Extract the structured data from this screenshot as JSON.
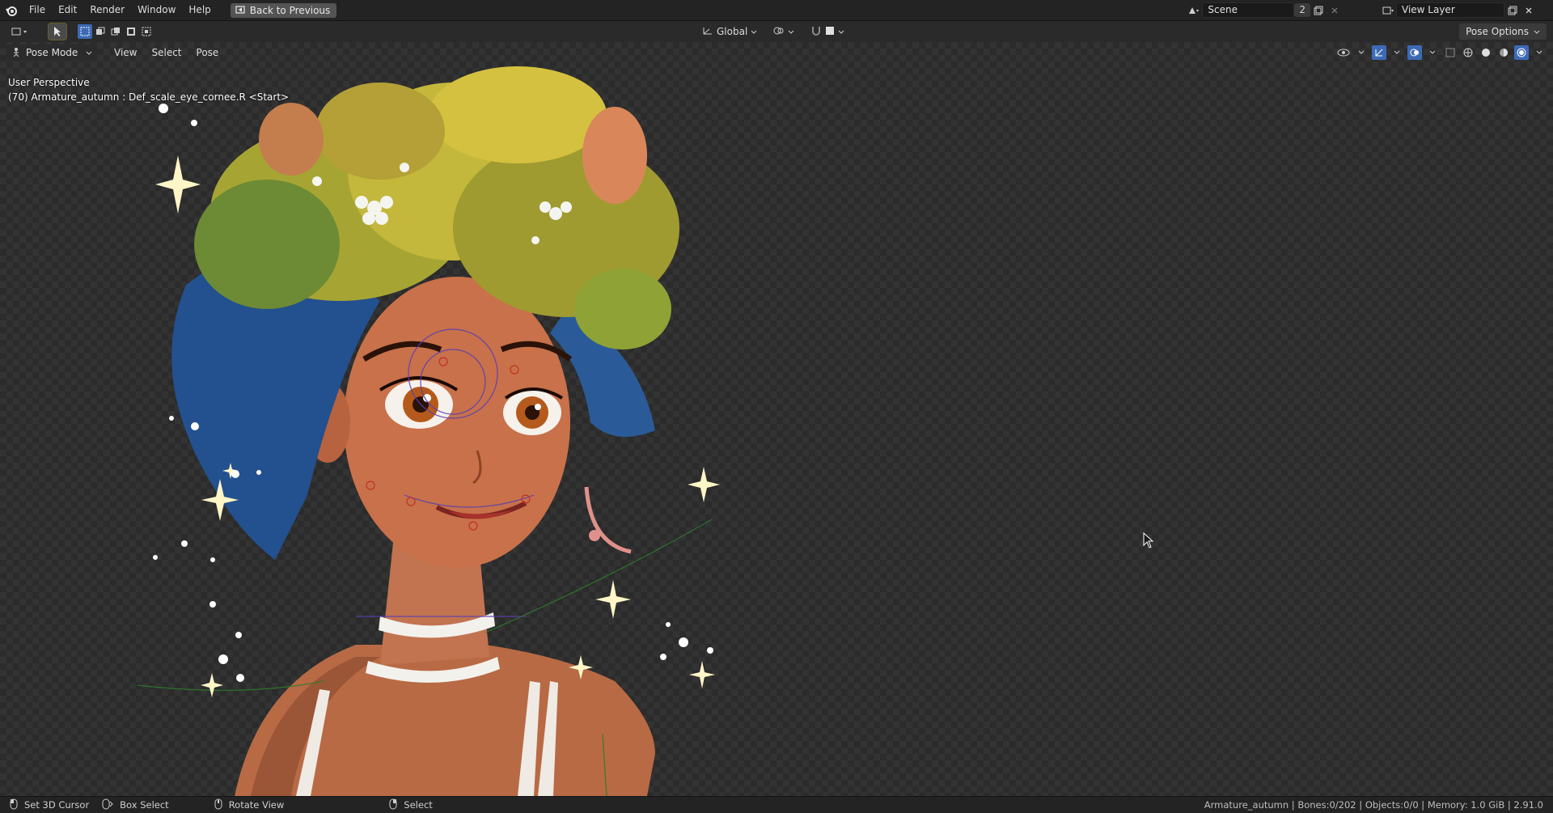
{
  "topbar": {
    "menus": [
      "File",
      "Edit",
      "Render",
      "Window",
      "Help"
    ],
    "back_button": "Back to Previous",
    "scene_name": "Scene",
    "scene_users": "2",
    "view_layer": "View Layer"
  },
  "toolbar": {
    "transform_orientation": "Global",
    "pose_options": "Pose Options"
  },
  "viewport": {
    "mode": "Pose Mode",
    "menus": [
      "View",
      "Select",
      "Pose"
    ],
    "perspective_label": "User Perspective",
    "active_object_label": "(70) Armature_autumn : Def_scale_eye_cornee.R <Start>"
  },
  "statusbar": {
    "hint_cursor": "Set 3D Cursor",
    "hint_box": "Box Select",
    "hint_rotate": "Rotate View",
    "hint_select": "Select",
    "stats": "Armature_autumn | Bones:0/202 | Objects:0/0 | Memory: 1.0 GiB | 2.91.0"
  },
  "colors": {
    "accent_blue": "#3d6ab5",
    "header_bg": "#232323",
    "viewport_bg": "#2b2b2b"
  }
}
